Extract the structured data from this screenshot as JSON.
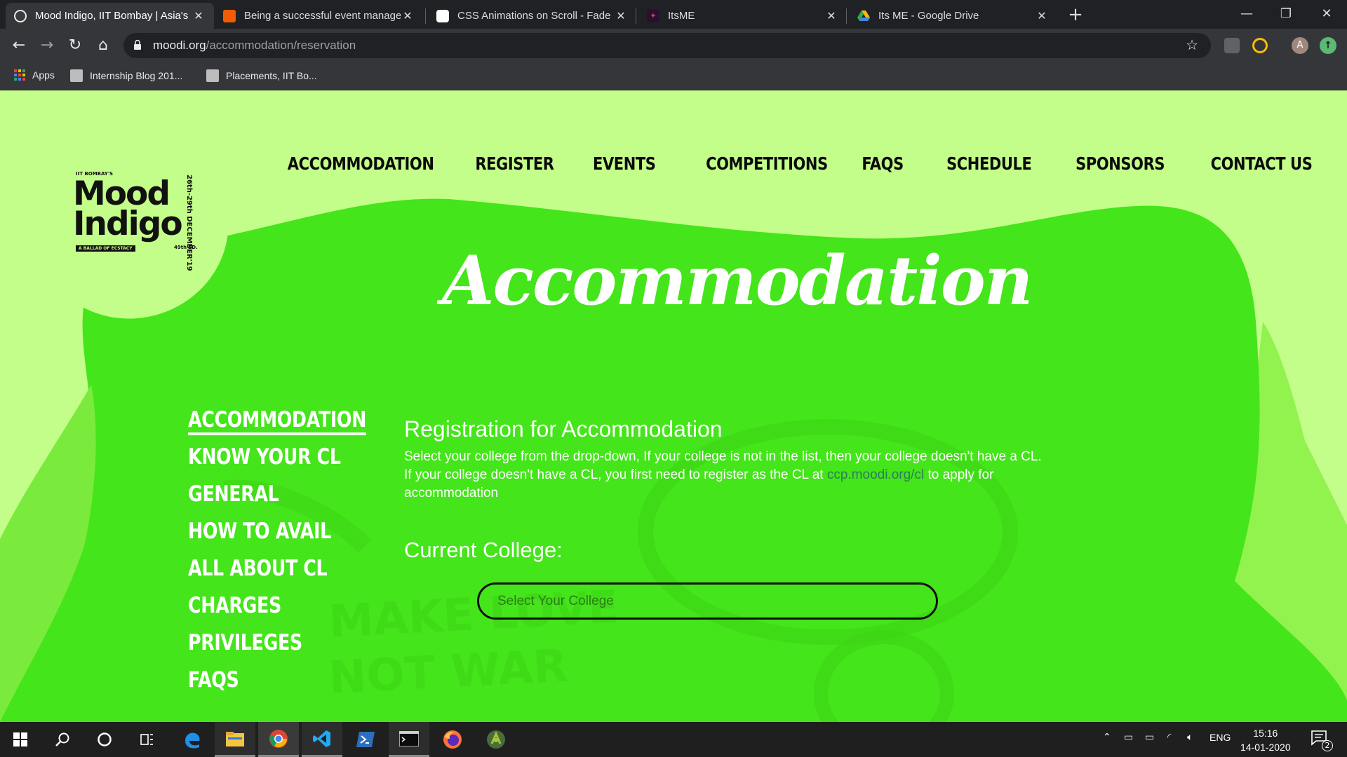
{
  "browser": {
    "tabs": [
      {
        "title": "Mood Indigo, IIT Bombay | Asia's",
        "active": true
      },
      {
        "title": "Being a successful event manage",
        "active": false
      },
      {
        "title": "CSS Animations on Scroll - Fade I",
        "active": false
      },
      {
        "title": "ItsME",
        "active": false
      },
      {
        "title": "Its ME - Google Drive",
        "active": false
      }
    ],
    "close_glyph": "✕",
    "new_tab": "+",
    "url_host": "moodi.org",
    "url_path": "/accommodation/reservation",
    "avatar_letter": "A",
    "bookmarks": [
      {
        "label": "Apps"
      },
      {
        "label": "Internship Blog 201..."
      },
      {
        "label": "Placements, IIT Bo..."
      }
    ]
  },
  "logo": {
    "top_text": "IIT BOMBAY'S",
    "line1": "Mood",
    "line2": "Indigo",
    "dates": "26th-29th DECEMBER'19",
    "tagline": "A BALLAD OF ECSTACY",
    "edition": "49th ED."
  },
  "topnav": [
    "ACCOMMODATION",
    "REGISTER",
    "EVENTS",
    "COMPETITIONS",
    "FAQS",
    "SCHEDULE",
    "SPONSORS",
    "CONTACT US"
  ],
  "hero_title": "Accommodation",
  "sidenav": {
    "active": "ACCOMMODATION",
    "items": [
      "ACCOMMODATION",
      "KNOW YOUR CL",
      "GENERAL",
      "HOW TO AVAIL",
      "ALL ABOUT CL",
      "CHARGES",
      "PRIVILEGES",
      "FAQS"
    ]
  },
  "content": {
    "heading": "Registration for Accommodation",
    "para1": "Select your college from the drop-down, If your college is not in the list, then your college doesn't have a CL.",
    "para2_before": "If your college doesn't have a CL, you first need to register as the CL at ",
    "para2_link": "ccp.moodi.org/cl",
    "para2_after": " to apply for accommodation",
    "college_label": "Current College:",
    "college_placeholder": "Select Your College"
  },
  "taskbar": {
    "language": "ENG",
    "time": "15:16",
    "date": "14-01-2020",
    "notification_count": "2"
  },
  "colors": {
    "page_bg": "#c3fd8a",
    "blob": "#44e51a",
    "blob_edge": "#92f24e",
    "logo_circle": "#c3fd8a",
    "text_dark": "#0b0b0b",
    "text_light": "#ffffff"
  }
}
